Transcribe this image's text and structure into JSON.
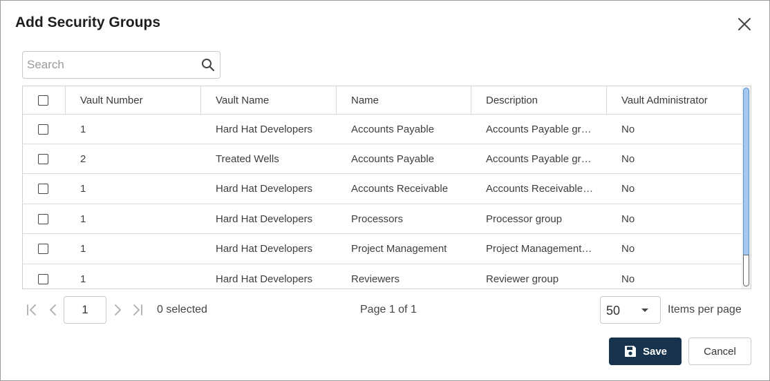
{
  "dialog": {
    "title": "Add Security Groups",
    "close_icon": "close-icon"
  },
  "search": {
    "placeholder": "Search",
    "value": "",
    "icon": "search-icon"
  },
  "table": {
    "columns": [
      "Vault Number",
      "Vault Name",
      "Name",
      "Description",
      "Vault Administrator"
    ],
    "rows": [
      {
        "vault_number": "1",
        "vault_name": "Hard Hat Developers",
        "name": "Accounts Payable",
        "description": "Accounts Payable gr…",
        "admin": "No",
        "checked": false
      },
      {
        "vault_number": "2",
        "vault_name": "Treated Wells",
        "name": "Accounts Payable",
        "description": "Accounts Payable gr…",
        "admin": "No",
        "checked": false
      },
      {
        "vault_number": "1",
        "vault_name": "Hard Hat Developers",
        "name": "Accounts Receivable",
        "description": "Accounts Receivable…",
        "admin": "No",
        "checked": false
      },
      {
        "vault_number": "1",
        "vault_name": "Hard Hat Developers",
        "name": "Processors",
        "description": "Processor group",
        "admin": "No",
        "checked": false
      },
      {
        "vault_number": "1",
        "vault_name": "Hard Hat Developers",
        "name": "Project Management",
        "description": "Project Management…",
        "admin": "No",
        "checked": false
      },
      {
        "vault_number": "1",
        "vault_name": "Hard Hat Developers",
        "name": "Reviewers",
        "description": "Reviewer group",
        "admin": "No",
        "checked": false
      }
    ]
  },
  "pager": {
    "current_page": "1",
    "selected_text": "0 selected",
    "page_info": "Page 1 of 1",
    "page_size": "50",
    "items_per_page_label": "Items per page"
  },
  "actions": {
    "save_label": "Save",
    "cancel_label": "Cancel"
  },
  "colors": {
    "save_bg": "#16324d",
    "scroll_thumb": "#a6c7ef"
  }
}
